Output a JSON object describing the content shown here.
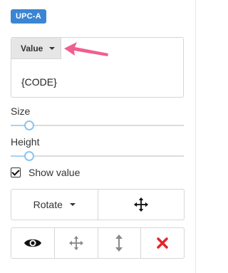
{
  "barcode_type": "UPC-A",
  "value_section": {
    "select_label": "Value",
    "content": "{CODE}"
  },
  "size": {
    "label": "Size",
    "value_fraction": 0.11
  },
  "height": {
    "label": "Height",
    "value_fraction": 0.11
  },
  "show_value": {
    "label": "Show value",
    "checked": true
  },
  "rotate_button": {
    "label": "Rotate"
  },
  "colors": {
    "accent": "#3a86d3",
    "arrow": "#ef5f91",
    "slider_thumb": "#8cc4ee",
    "delete_icon": "#e3262a"
  },
  "icons": {
    "move": "move-arrows-icon",
    "view": "eye-icon",
    "drag": "move-arrows-icon",
    "resize": "vertical-resize-icon",
    "delete": "close-x-icon"
  }
}
